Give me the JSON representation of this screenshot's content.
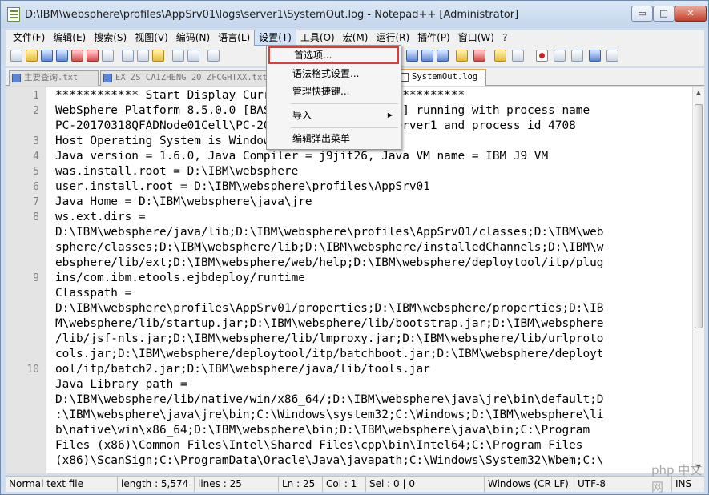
{
  "window": {
    "title": "D:\\IBM\\websphere\\profiles\\AppSrv01\\logs\\server1\\SystemOut.log - Notepad++ [Administrator]",
    "min_glyph": "▭",
    "max_glyph": "□",
    "close_glyph": "✕"
  },
  "menubar": [
    {
      "label": "文件(F)"
    },
    {
      "label": "编辑(E)"
    },
    {
      "label": "搜索(S)"
    },
    {
      "label": "视图(V)"
    },
    {
      "label": "编码(N)"
    },
    {
      "label": "语言(L)"
    },
    {
      "label": "设置(T)"
    },
    {
      "label": "工具(O)"
    },
    {
      "label": "宏(M)"
    },
    {
      "label": "运行(R)"
    },
    {
      "label": "插件(P)"
    },
    {
      "label": "窗口(W)"
    },
    {
      "label": "?"
    }
  ],
  "settings_menu": {
    "items": [
      {
        "label": "首选项..."
      },
      {
        "label": "语法格式设置..."
      },
      {
        "label": "管理快捷键..."
      },
      {
        "label": "导入"
      },
      {
        "label": "编辑弹出菜单"
      }
    ],
    "submenu_arrow": "▶"
  },
  "tabs": [
    {
      "label": "主要查询.txt"
    },
    {
      "label": "EX_ZS_CAIZHENG_20_ZFCGHTXX.txt"
    },
    {
      "label": "SystemOut.log"
    }
  ],
  "tab_close_glyph": "x",
  "editor": {
    "line_numbers": [
      "1",
      "2",
      "",
      "3",
      "4",
      "5",
      "6",
      "7",
      "8",
      "",
      "",
      "",
      "9",
      "",
      "",
      "",
      "",
      "",
      "10",
      "",
      "",
      "",
      "",
      ""
    ],
    "lines": [
      "************ Start Display Current Environment ************",
      "WebSphere Platform 8.5.0.0 [BASE 8.5.0.0 gm1218.01] running with process name",
      "PC-20170318QFADNode01Cell\\PC-20170318QFADNode01\\server1 and process id 4708",
      "Host Operating System is Windows 7, version 6.1",
      "Java version = 1.6.0, Java Compiler = j9jit26, Java VM name = IBM J9 VM",
      "was.install.root = D:\\IBM\\websphere",
      "user.install.root = D:\\IBM\\websphere\\profiles\\AppSrv01",
      "Java Home = D:\\IBM\\websphere\\java\\jre",
      "ws.ext.dirs =",
      "D:\\IBM\\websphere/java/lib;D:\\IBM\\websphere\\profiles\\AppSrv01/classes;D:\\IBM\\web",
      "sphere/classes;D:\\IBM\\websphere/lib;D:\\IBM\\websphere/installedChannels;D:\\IBM\\w",
      "ebsphere/lib/ext;D:\\IBM\\websphere/web/help;D:\\IBM\\websphere/deploytool/itp/plug",
      "ins/com.ibm.etools.ejbdeploy/runtime",
      "Classpath =",
      "D:\\IBM\\websphere\\profiles\\AppSrv01/properties;D:\\IBM\\websphere/properties;D:\\IB",
      "M\\websphere/lib/startup.jar;D:\\IBM\\websphere/lib/bootstrap.jar;D:\\IBM\\websphere",
      "/lib/jsf-nls.jar;D:\\IBM\\websphere/lib/lmproxy.jar;D:\\IBM\\websphere/lib/urlproto",
      "cols.jar;D:\\IBM\\websphere/deploytool/itp/batchboot.jar;D:\\IBM\\websphere/deployt",
      "ool/itp/batch2.jar;D:\\IBM\\websphere/java/lib/tools.jar",
      "Java Library path =",
      "D:\\IBM\\websphere/lib/native/win/x86_64/;D:\\IBM\\websphere\\java\\jre\\bin\\default;D",
      ":\\IBM\\websphere\\java\\jre\\bin;C:\\Windows\\system32;C:\\Windows;D:\\IBM\\websphere\\li",
      "b\\native\\win\\x86_64;D:\\IBM\\websphere\\bin;D:\\IBM\\websphere\\java\\bin;C:\\Program",
      "Files (x86)\\Common Files\\Intel\\Shared Files\\cpp\\bin\\Intel64;C:\\Program Files",
      "(x86)\\ScanSign;C:\\ProgramData\\Oracle\\Java\\javapath;C:\\Windows\\System32\\Wbem;C:\\"
    ]
  },
  "statusbar": {
    "file_type": "Normal text file",
    "length": "length : 5,574",
    "lines": "lines : 25",
    "ln": "Ln : 25",
    "col": "Col : 1",
    "sel": "Sel : 0 | 0",
    "eol": "Windows (CR LF)",
    "encoding": "UTF-8",
    "mode": "INS"
  },
  "watermark": "php 中文网",
  "colors": {
    "highlight_border": "#e23a3a",
    "active_tab_accent": "#f0a030"
  }
}
